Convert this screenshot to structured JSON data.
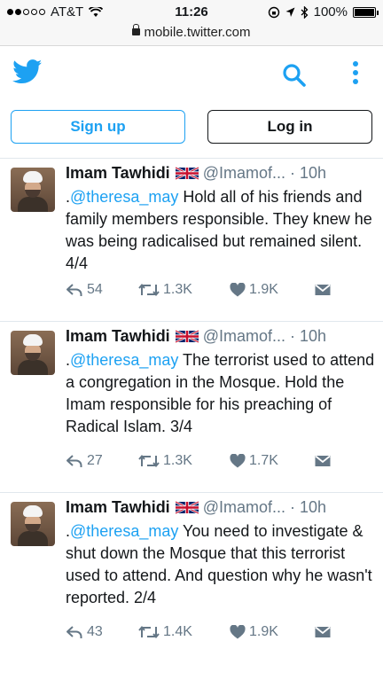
{
  "status_bar": {
    "carrier": "AT&T",
    "time": "11:26",
    "battery": "100%",
    "url": "mobile.twitter.com"
  },
  "header": {
    "logo_icon": "twitter-bird-icon",
    "search_icon": "search-icon",
    "more_icon": "more-vertical-icon"
  },
  "auth": {
    "signup_label": "Sign up",
    "login_label": "Log in"
  },
  "tweets": [
    {
      "name": "Imam Tawhidi",
      "handle": "@Imamof...",
      "sep": "·",
      "time": "10h",
      "prefix": ".",
      "mention": "@theresa_may",
      "text": " Hold all of his friends and family members responsible. They knew he was being radicalised but remained silent. 4/4",
      "replies": "54",
      "retweets": "1.3K",
      "likes": "1.9K"
    },
    {
      "name": "Imam Tawhidi",
      "handle": "@Imamof...",
      "sep": "·",
      "time": "10h",
      "prefix": ".",
      "mention": "@theresa_may",
      "text": " The terrorist used to attend a congregation in the Mosque. Hold the Imam responsible for his preaching of Radical Islam. 3/4",
      "replies": "27",
      "retweets": "1.3K",
      "likes": "1.7K"
    },
    {
      "name": "Imam Tawhidi",
      "handle": "@Imamof...",
      "sep": "·",
      "time": "10h",
      "prefix": ".",
      "mention": "@theresa_may",
      "text": " You need to investigate & shut down the Mosque that this terrorist used to attend. And question why he wasn't reported. 2/4",
      "replies": "43",
      "retweets": "1.4K",
      "likes": "1.9K"
    }
  ],
  "colors": {
    "accent": "#1da1f2",
    "muted": "#657786"
  }
}
